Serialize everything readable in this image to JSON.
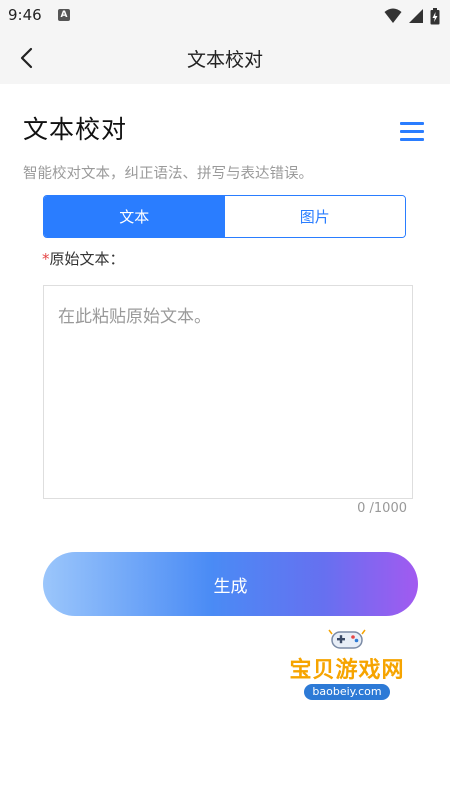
{
  "status_bar": {
    "time": "9:46",
    "notification_icon": "A"
  },
  "header": {
    "title": "文本校对"
  },
  "main": {
    "heading": "文本校对",
    "subtitle": "智能校对文本，纠正语法、拼写与表达错误。",
    "tabs": [
      {
        "label": "文本",
        "active": true
      },
      {
        "label": "图片",
        "active": false
      }
    ],
    "field": {
      "required_mark": "*",
      "label": "原始文本：",
      "placeholder": "在此粘贴原始文本。",
      "char_count": "0 /1000"
    },
    "generate_label": "生成"
  },
  "watermark": {
    "text": "宝贝游戏网",
    "url": "baobeiy.com"
  },
  "colors": {
    "accent": "#2a7dff",
    "required": "#e54545"
  }
}
